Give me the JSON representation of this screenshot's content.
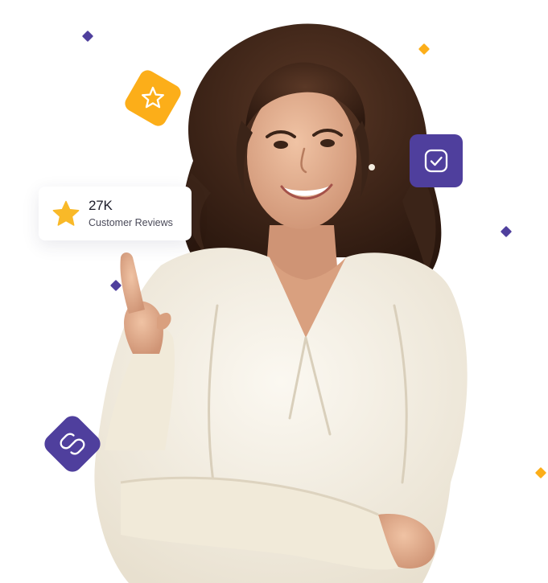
{
  "reviews": {
    "count": "27K",
    "label": "Customer Reviews",
    "icon": "star-icon"
  },
  "icons": {
    "star_badge": "star-outline-icon",
    "check_badge": "check-square-icon",
    "link_badge": "link-icon"
  },
  "colors": {
    "brand_purple": "#4f3f9d",
    "accent_orange": "#fcae19",
    "star_yellow": "#f9b928",
    "text_dark": "#1d1d2a",
    "text_muted": "#4b4b5a",
    "shirt": "#f4efe4",
    "skin": "#d9a07f",
    "hair": "#3b2418"
  }
}
